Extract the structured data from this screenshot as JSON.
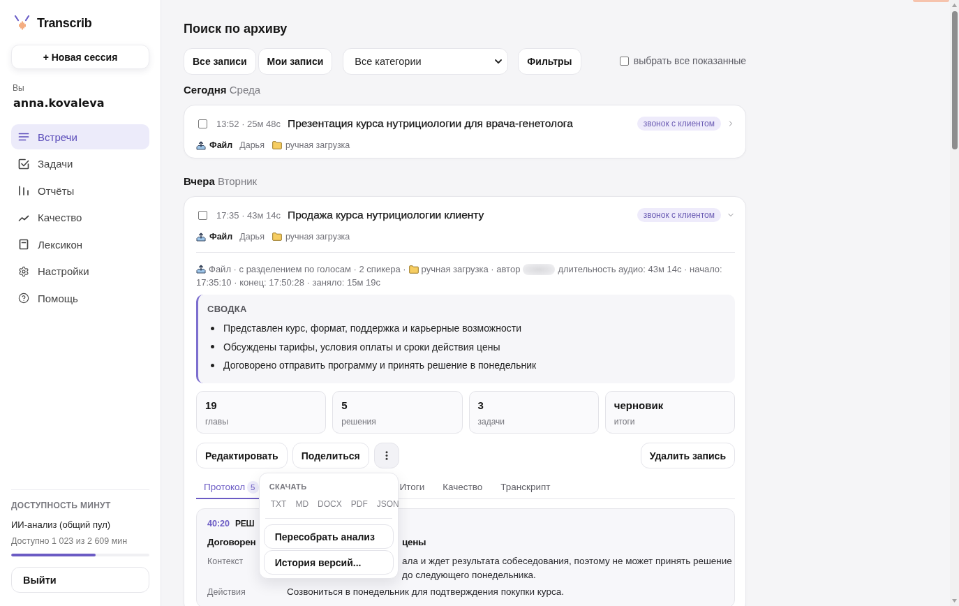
{
  "sidebar": {
    "brand": "Transcrib",
    "new_session": "+ Новая сессия",
    "user_label": "Вы",
    "user_name": "anna.kovaleva",
    "nav": [
      {
        "label": "Встречи",
        "selected": true
      },
      {
        "label": "Задачи",
        "selected": false
      },
      {
        "label": "Отчёты",
        "selected": false
      },
      {
        "label": "Качество",
        "selected": false
      },
      {
        "label": "Лексикон",
        "selected": false
      },
      {
        "label": "Настройки",
        "selected": false
      },
      {
        "label": "Помощь",
        "selected": false
      }
    ],
    "minutes": {
      "heading": "ДОСТУПНОСТЬ МИНУТ",
      "pool": "ИИ-анализ (общий пул)",
      "available": "Доступно 1 023 из 2 609 мин",
      "level": 0.61
    },
    "logout": "Выйти"
  },
  "archive": {
    "title": "Поиск по архиву",
    "scopes": [
      "Все записи",
      "Мои записи"
    ],
    "category": "Все категории",
    "filters": "Фильтры",
    "select_all": {
      "label": "выбрать все показанные",
      "checked": false
    },
    "groups": [
      {
        "day": "Сегодня",
        "weekday": "Среда",
        "sessions": [
          {
            "checked": false,
            "time": "13:52 · 25м 48с",
            "title": "Презентация курса нутрициологии для врача-генетолога",
            "tag": "звонок с клиентом",
            "expanded": false,
            "source": "Файл",
            "speaker": "Дарья",
            "upload": "ручная загрузка"
          }
        ]
      },
      {
        "day": "Вчера",
        "weekday": "Вторник",
        "sessions": [
          {
            "checked": false,
            "time": "17:35 · 43м 14с",
            "title": "Продажа курса нутрициологии клиенту",
            "tag": "звонок с клиентом",
            "expanded": true,
            "source": "Файл",
            "speaker": "Дарья",
            "upload": "ручная загрузка",
            "details": {
              "lines": [
                [
                  {
                    "kind": "upload",
                    "text": "Файл · с разделением по голосам · 2 спикера ·"
                  },
                  {
                    "kind": "folder",
                    "text": "ручная загрузка · автор"
                  },
                  {
                    "kind": "redacted"
                  },
                  {
                    "kind": "text",
                    "text": "длительность аудио: 43м 14с · начало:"
                  }
                ],
                [
                  {
                    "kind": "text",
                    "text": "17:35:10 · конец: 17:50:28 · заняло: 15м 19с"
                  }
                ]
              ]
            },
            "summary": {
              "heading": "СВОДКА",
              "points": [
                "Представлен курс, формат, поддержка и карьерные возможности",
                "Обсуждены тарифы, условия оплаты и сроки действия цены",
                "Договорено отправить программу и принять решение в понедельник"
              ]
            },
            "stats": [
              {
                "value": "19",
                "label": "главы"
              },
              {
                "value": "5",
                "label": "решения"
              },
              {
                "value": "3",
                "label": "задачи"
              },
              {
                "value": "черновик",
                "label": "итоги"
              }
            ],
            "actions": {
              "buttons": [
                "Редактировать",
                "Поделиться"
              ],
              "delete": "Удалить запись",
              "menu": {
                "open": true,
                "section": "СКАЧАТЬ",
                "formats": [
                  "TXT",
                  "MD",
                  "DOCX",
                  "PDF",
                  "JSON"
                ],
                "items": [
                  "Пересобрать анализ",
                  "История версий..."
                ]
              }
            },
            "tabs": [
              {
                "label": "Протокол",
                "badge": "5",
                "selected": true
              },
              {
                "label": "Итоги",
                "selected": false
              },
              {
                "label": "Качество",
                "selected": false
              },
              {
                "label": "Транскрипт",
                "selected": false
              }
            ],
            "protocol": {
              "time": "40:20",
              "type": "РЕШ",
              "title_parts": [
                "Договорен",
                "цены"
              ],
              "fields": [
                {
                  "label": "Контекст",
                  "lines": [
                    {
                      "text": "ала и ждет результата собеседования, поэтому не может принять решение",
                      "cut": true
                    },
                    {
                      "text": "до следующего понедельника.",
                      "cut": true
                    }
                  ]
                },
                {
                  "label": "Действия",
                  "lines": [
                    {
                      "text": "Созвониться в понедельник для подтверждения покупки курса.",
                      "cut": false
                    }
                  ]
                }
              ]
            }
          }
        ]
      }
    ]
  }
}
